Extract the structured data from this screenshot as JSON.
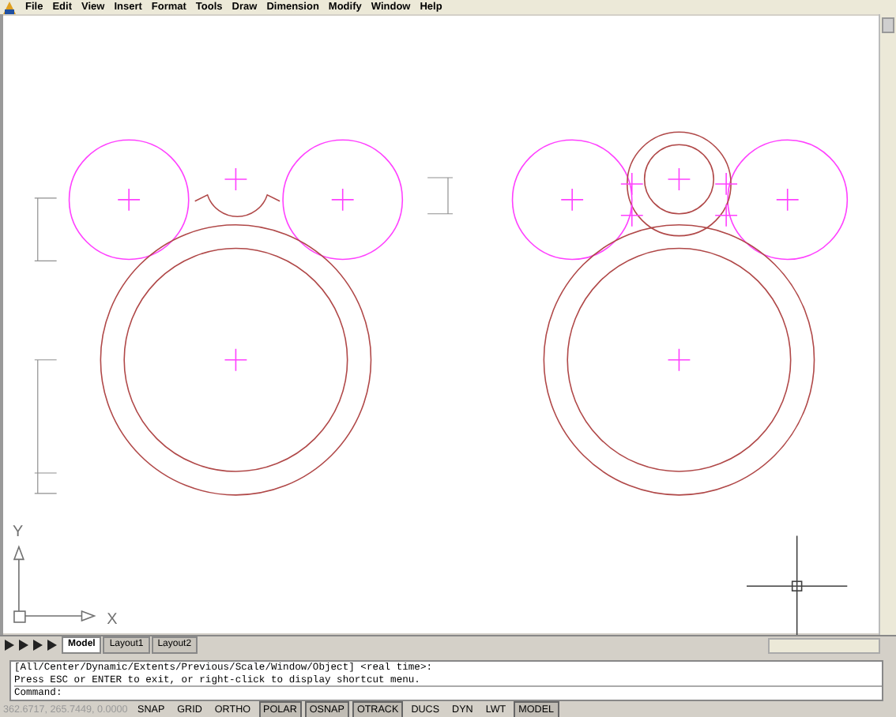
{
  "menu_bar": {
    "items": [
      "File",
      "Edit",
      "View",
      "Insert",
      "Format",
      "Tools",
      "Draw",
      "Dimension",
      "Modify",
      "Window",
      "Help"
    ]
  },
  "layout_tabs": [
    {
      "label": "Model",
      "selected": true
    },
    {
      "label": "Layout1",
      "selected": false
    },
    {
      "label": "Layout2",
      "selected": false
    }
  ],
  "ucs_icon": {
    "x_label": "X",
    "y_label": "Y"
  },
  "command_window": {
    "history": [
      "[All/Center/Dynamic/Extents/Previous/Scale/Window/Object] <real time>:",
      "Press ESC or ENTER to exit, or right-click to display shortcut menu."
    ],
    "prompt": "Command:"
  },
  "status_bar": {
    "coordinates": "362.6717, 265.7449, 0.0000",
    "toggles": [
      {
        "label": "SNAP",
        "on": false
      },
      {
        "label": "GRID",
        "on": false
      },
      {
        "label": "ORTHO",
        "on": false
      },
      {
        "label": "POLAR",
        "on": true
      },
      {
        "label": "OSNAP",
        "on": true
      },
      {
        "label": "OTRACK",
        "on": true
      },
      {
        "label": "DUCS",
        "on": false
      },
      {
        "label": "DYN",
        "on": false
      },
      {
        "label": "LWT",
        "on": false
      },
      {
        "label": "MODEL",
        "on": true
      }
    ]
  }
}
